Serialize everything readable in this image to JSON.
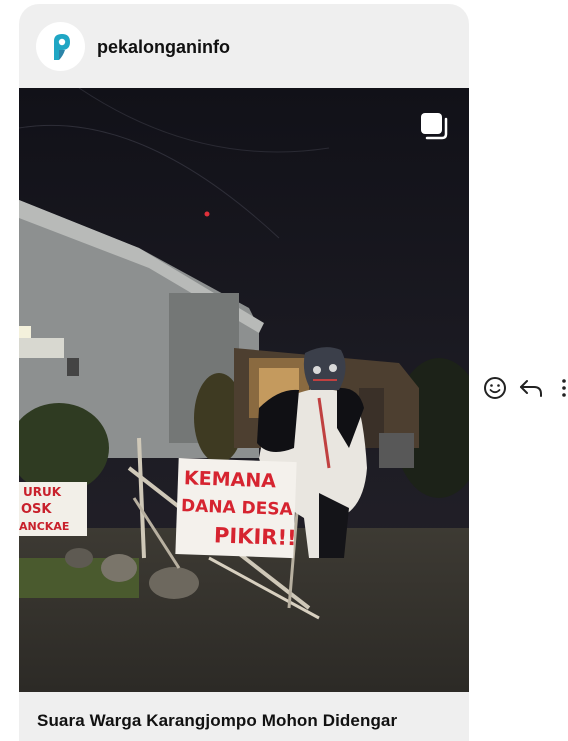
{
  "post": {
    "username": "pekalonganinfo",
    "avatar_icon": "pekalongan-p-logo",
    "caption": "Suara Warga Karangjompo Mohon Didengar",
    "media": {
      "multi_icon": "carousel-icon",
      "sign_main": [
        "KEMANA",
        "DANA DESA",
        "PIKIR!!"
      ],
      "sign_left": [
        "URUK",
        "OSK",
        "ANCKAE"
      ]
    }
  },
  "actions": [
    {
      "icon": "emoji-icon"
    },
    {
      "icon": "reply-icon"
    },
    {
      "icon": "more-vertical-icon"
    }
  ]
}
